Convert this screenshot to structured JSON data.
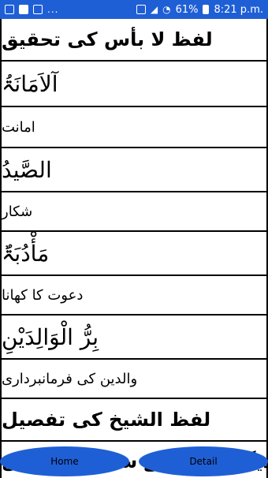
{
  "status_bar": {
    "battery": "61%",
    "time": "8:21 p.m.",
    "dots": "...",
    "icons": [
      "image-icon",
      "messenger-icon",
      "message-icon",
      "sim-icon",
      "signal-icon",
      "wifi-icon",
      "battery-icon"
    ]
  },
  "list": {
    "items": [
      {
        "text": "لفظ لا بأس کی تحقیق",
        "style": "heading"
      },
      {
        "text": "آلاَمَانَۃُ",
        "style": "arabic"
      },
      {
        "text": "امانت",
        "style": "meaning"
      },
      {
        "text": "الصَّیدُ",
        "style": "arabic"
      },
      {
        "text": "شکار",
        "style": "meaning"
      },
      {
        "text": "مَأْدُبَۃٌ",
        "style": "arabic"
      },
      {
        "text": "دعوت کا کھانا",
        "style": "meaning"
      },
      {
        "text": "بِرُّ الْوَالِدَیْنِ",
        "style": "arabic"
      },
      {
        "text": "والدین کی فرمانبرداری",
        "style": "meaning"
      },
      {
        "text": "لفظ الشیخ کی تفصیل",
        "style": "heading"
      },
      {
        "text": "دیگر الفاظ کے ساتھ استعمال",
        "style": "heading"
      }
    ]
  },
  "bottom_bar": {
    "home_label": "Home",
    "detail_label": "Detail"
  },
  "colors": {
    "status_bar": "#1f5fd6",
    "button": "#1f5fd6"
  }
}
